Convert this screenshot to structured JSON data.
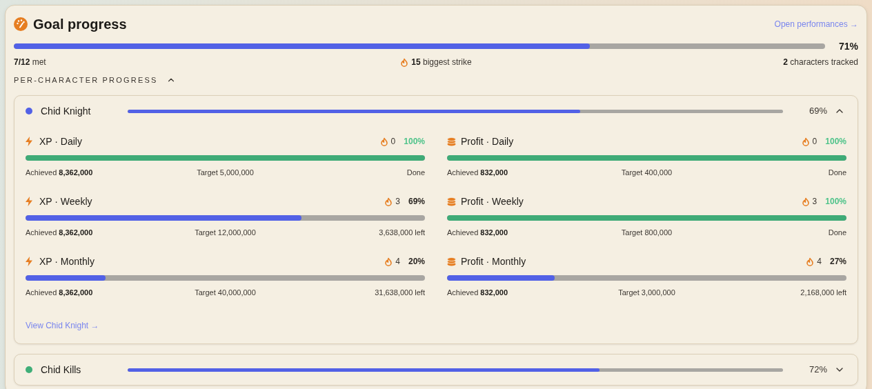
{
  "header": {
    "title": "Goal progress",
    "link": "Open performances →",
    "level": 0.71,
    "percent": "71%",
    "met_count": "7/12",
    "met_label": "met",
    "strike_count": "15",
    "strike_label": "biggest strike",
    "tracked_count": "2",
    "tracked_label": "characters tracked"
  },
  "section": {
    "label": "PER-CHARACTER PROGRESS",
    "expanded": true
  },
  "characters": [
    {
      "name": "Chid Knight",
      "color": "#5261e6",
      "level": 0.69,
      "percent": "69%",
      "expanded": true,
      "link": "View Chid Knight →",
      "goals": [
        {
          "kind": "xp",
          "title": "XP · Daily",
          "streak": "0",
          "percent": "100%",
          "level": 1,
          "complete": true,
          "achieved_label": "Achieved",
          "achieved": "8,362,000",
          "target": "Target 5,000,000",
          "remaining": "Done"
        },
        {
          "kind": "profit",
          "title": "Profit · Daily",
          "streak": "0",
          "percent": "100%",
          "level": 1,
          "complete": true,
          "achieved_label": "Achieved",
          "achieved": "832,000",
          "target": "Target 400,000",
          "remaining": "Done"
        },
        {
          "kind": "xp",
          "title": "XP · Weekly",
          "streak": "3",
          "percent": "69%",
          "level": 0.69,
          "complete": false,
          "achieved_label": "Achieved",
          "achieved": "8,362,000",
          "target": "Target 12,000,000",
          "remaining": "3,638,000 left"
        },
        {
          "kind": "profit",
          "title": "Profit · Weekly",
          "streak": "3",
          "percent": "100%",
          "level": 1,
          "complete": true,
          "achieved_label": "Achieved",
          "achieved": "832,000",
          "target": "Target 800,000",
          "remaining": "Done"
        },
        {
          "kind": "xp",
          "title": "XP · Monthly",
          "streak": "4",
          "percent": "20%",
          "level": 0.2,
          "complete": false,
          "achieved_label": "Achieved",
          "achieved": "8,362,000",
          "target": "Target 40,000,000",
          "remaining": "31,638,000 left"
        },
        {
          "kind": "profit",
          "title": "Profit · Monthly",
          "streak": "4",
          "percent": "27%",
          "level": 0.27,
          "complete": false,
          "achieved_label": "Achieved",
          "achieved": "832,000",
          "target": "Target 3,000,000",
          "remaining": "2,168,000 left"
        }
      ]
    },
    {
      "name": "Chid Kills",
      "color": "#3fae78",
      "level": 0.72,
      "percent": "72%",
      "expanded": false
    }
  ]
}
